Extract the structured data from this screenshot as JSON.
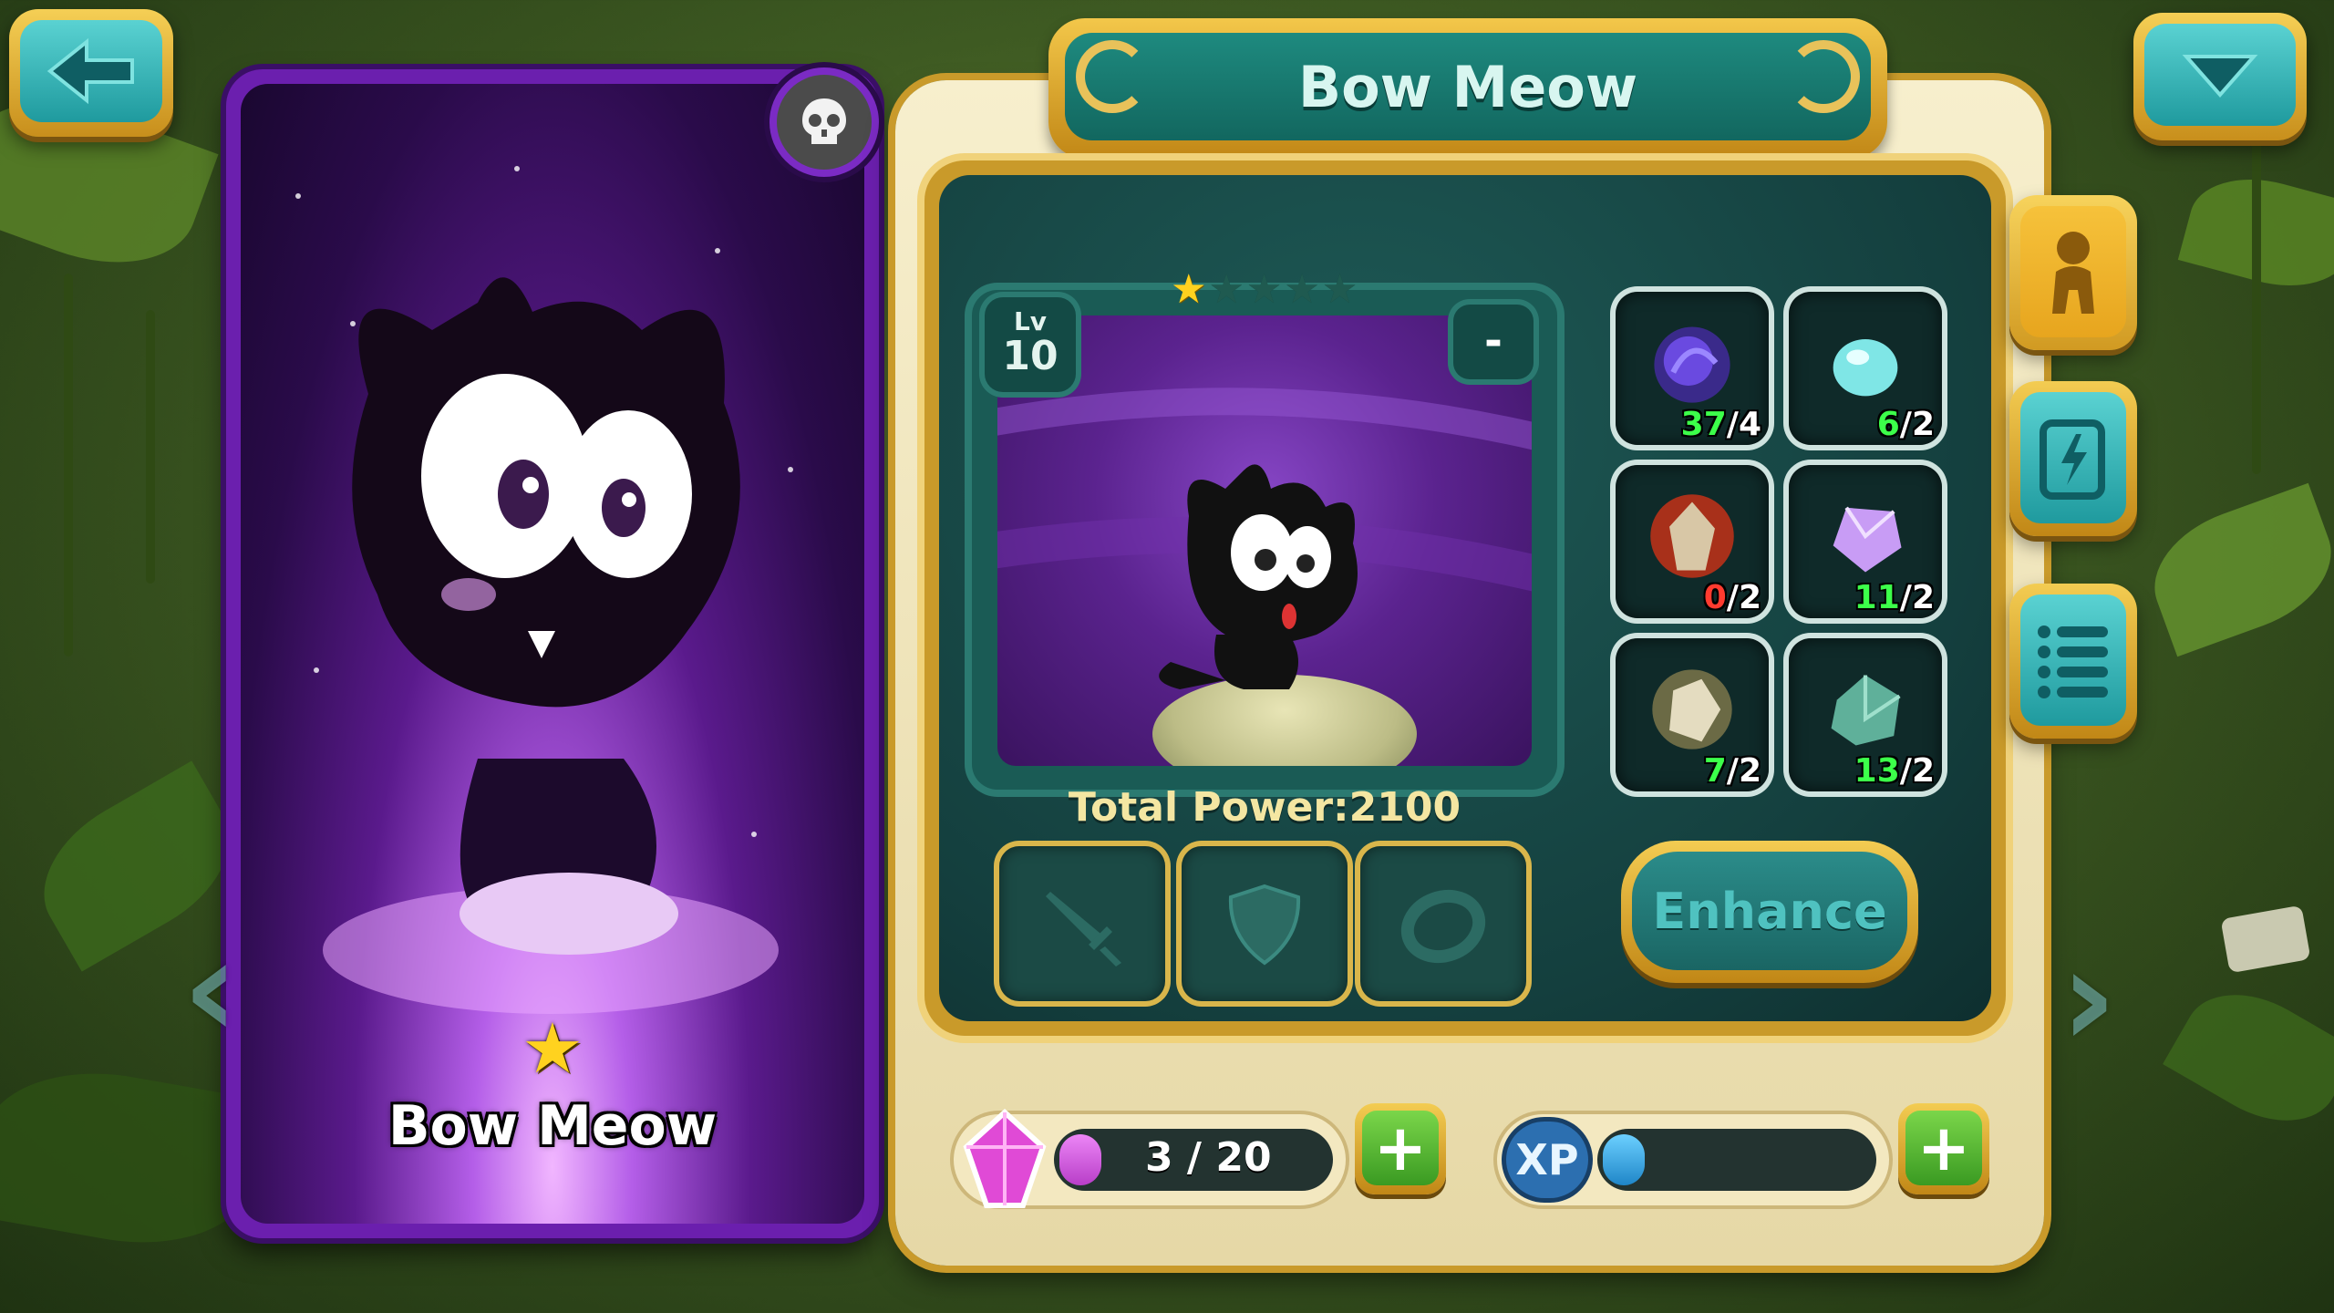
{
  "hero": {
    "name": "Bow Meow",
    "card_stars": 1,
    "level_label": "Lv",
    "level": "10",
    "slot_badge": "-",
    "rating": {
      "filled": 1,
      "total": 5
    },
    "total_power_label": "Total Power:",
    "total_power": "2100"
  },
  "title": "Bow Meow",
  "navigation": {
    "back_icon": "back-arrow-icon",
    "menu_icon": "chevron-down-icon"
  },
  "equipment": [
    {
      "icon": "sword-icon"
    },
    {
      "icon": "shield-icon"
    },
    {
      "icon": "ring-icon"
    }
  ],
  "materials": [
    {
      "icon": "dark-orb-icon",
      "have": "37",
      "need": "4",
      "color": "#5a3fbf"
    },
    {
      "icon": "aqua-gem-icon",
      "have": "6",
      "need": "2",
      "color": "#7fe6e6"
    },
    {
      "icon": "fire-crystal-icon",
      "have": "0",
      "need": "2",
      "color": "#d04a1a"
    },
    {
      "icon": "amethyst-icon",
      "have": "11",
      "need": "2",
      "color": "#c89cf5"
    },
    {
      "icon": "quartz-icon",
      "have": "7",
      "need": "2",
      "color": "#d9d2b0"
    },
    {
      "icon": "jade-stone-icon",
      "have": "13",
      "need": "2",
      "color": "#5fb09a"
    }
  ],
  "enhance_label": "Enhance",
  "side_tabs": [
    {
      "icon": "character-icon",
      "active": true
    },
    {
      "icon": "skill-scroll-icon",
      "active": false
    },
    {
      "icon": "list-icon",
      "active": false
    }
  ],
  "soulstones": {
    "label": "3 / 20",
    "have": 3,
    "max": 20,
    "color": "#d65ae6"
  },
  "xp": {
    "label": "XP",
    "fill": 0.15,
    "color": "#3aa6e8"
  },
  "colors": {
    "gold": "#c99a2a",
    "teal": "#1e8a7f",
    "purple": "#6b1fae"
  }
}
